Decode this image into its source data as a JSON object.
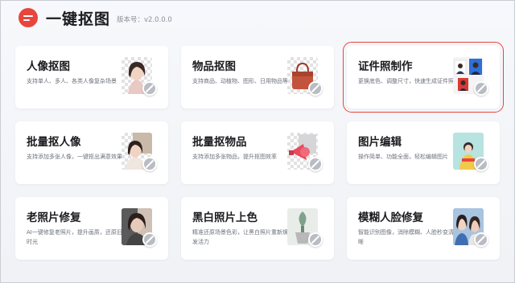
{
  "app": {
    "title": "一键抠图",
    "version": "版本号：v2.0.0.0"
  },
  "colors": {
    "accent": "#e8453c",
    "selection_outline": "#e8453c"
  },
  "cards": [
    {
      "title": "人像抠图",
      "desc": "支持单人、多人、各类人像复杂场景",
      "icon": "portrait-thumbnail"
    },
    {
      "title": "物品抠图",
      "desc": "支持商品、动植物、图形、日用物品等",
      "icon": "handbag-thumbnail"
    },
    {
      "title": "证件照制作",
      "desc": "更换底色、调整尺寸，快速生成证件照",
      "icon": "id-photo-thumbnail",
      "selected": true
    },
    {
      "title": "批量抠人像",
      "desc": "支持添加多张人像，一键抠出满意效果",
      "icon": "batch-portrait-thumbnail"
    },
    {
      "title": "批量抠物品",
      "desc": "支持添加多张物品，提升抠图效率",
      "icon": "batch-object-thumbnail"
    },
    {
      "title": "图片编辑",
      "desc": "操作简单、功能全面，轻松编辑图片",
      "icon": "image-edit-thumbnail"
    },
    {
      "title": "老照片修复",
      "desc": "AI一键修复老照片，提升画质，还原旧时光",
      "icon": "old-photo-thumbnail"
    },
    {
      "title": "黑白照片上色",
      "desc": "精准还原场景色彩，让黑白照片重新焕发活力",
      "icon": "colorize-thumbnail"
    },
    {
      "title": "模糊人脸修复",
      "desc": "智能识别图像，消除模糊、人脸秒变清晰",
      "icon": "face-restore-thumbnail"
    }
  ]
}
